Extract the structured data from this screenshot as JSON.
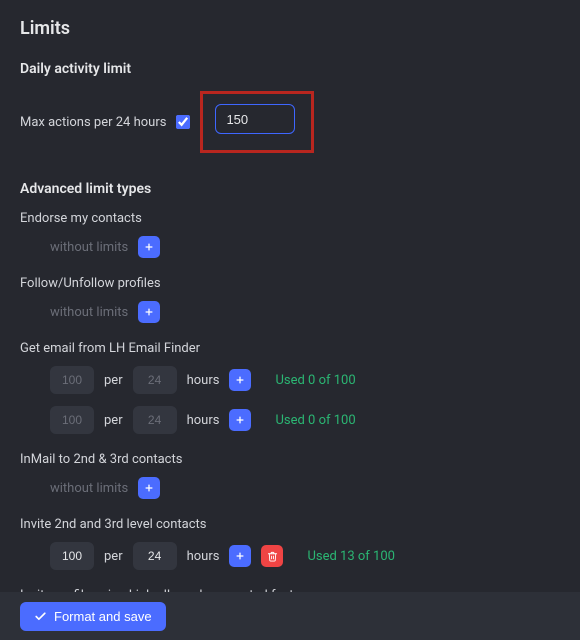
{
  "header": {
    "title": "Limits"
  },
  "daily": {
    "section_title": "Daily activity limit",
    "label": "Max actions per 24 hours",
    "checked": true,
    "value": "150"
  },
  "advanced": {
    "section_title": "Advanced limit types",
    "without_limits_label": "without limits",
    "per_label": "per",
    "hours_label": "hours",
    "groups": [
      {
        "title": "Endorse my contacts",
        "rows": [
          {
            "type": "none"
          }
        ]
      },
      {
        "title": "Follow/Unfollow profiles",
        "rows": [
          {
            "type": "none"
          }
        ]
      },
      {
        "title": "Get email from LH Email Finder",
        "rows": [
          {
            "type": "rule",
            "count": "100",
            "count_dim": true,
            "per": "24",
            "per_dim": true,
            "used": "Used 0 of 100",
            "deletable": false
          },
          {
            "type": "rule",
            "count": "100",
            "count_dim": true,
            "per": "24",
            "per_dim": true,
            "used": "Used 0 of 100",
            "deletable": false
          }
        ]
      },
      {
        "title": "InMail to 2nd & 3rd contacts",
        "rows": [
          {
            "type": "none"
          }
        ]
      },
      {
        "title": "Invite 2nd and 3rd level contacts",
        "rows": [
          {
            "type": "rule",
            "count": "100",
            "count_dim": false,
            "per": "24",
            "per_dim": false,
            "used": "Used 13 of 100",
            "deletable": true
          }
        ]
      },
      {
        "title": "Invite profile using LinkedIn undocumented feature",
        "rows": [
          {
            "type": "none"
          }
        ]
      }
    ]
  },
  "footer": {
    "save_label": "Format and save"
  },
  "icons": {
    "plus": "+",
    "check": "check-icon",
    "trash": "trash-icon"
  }
}
